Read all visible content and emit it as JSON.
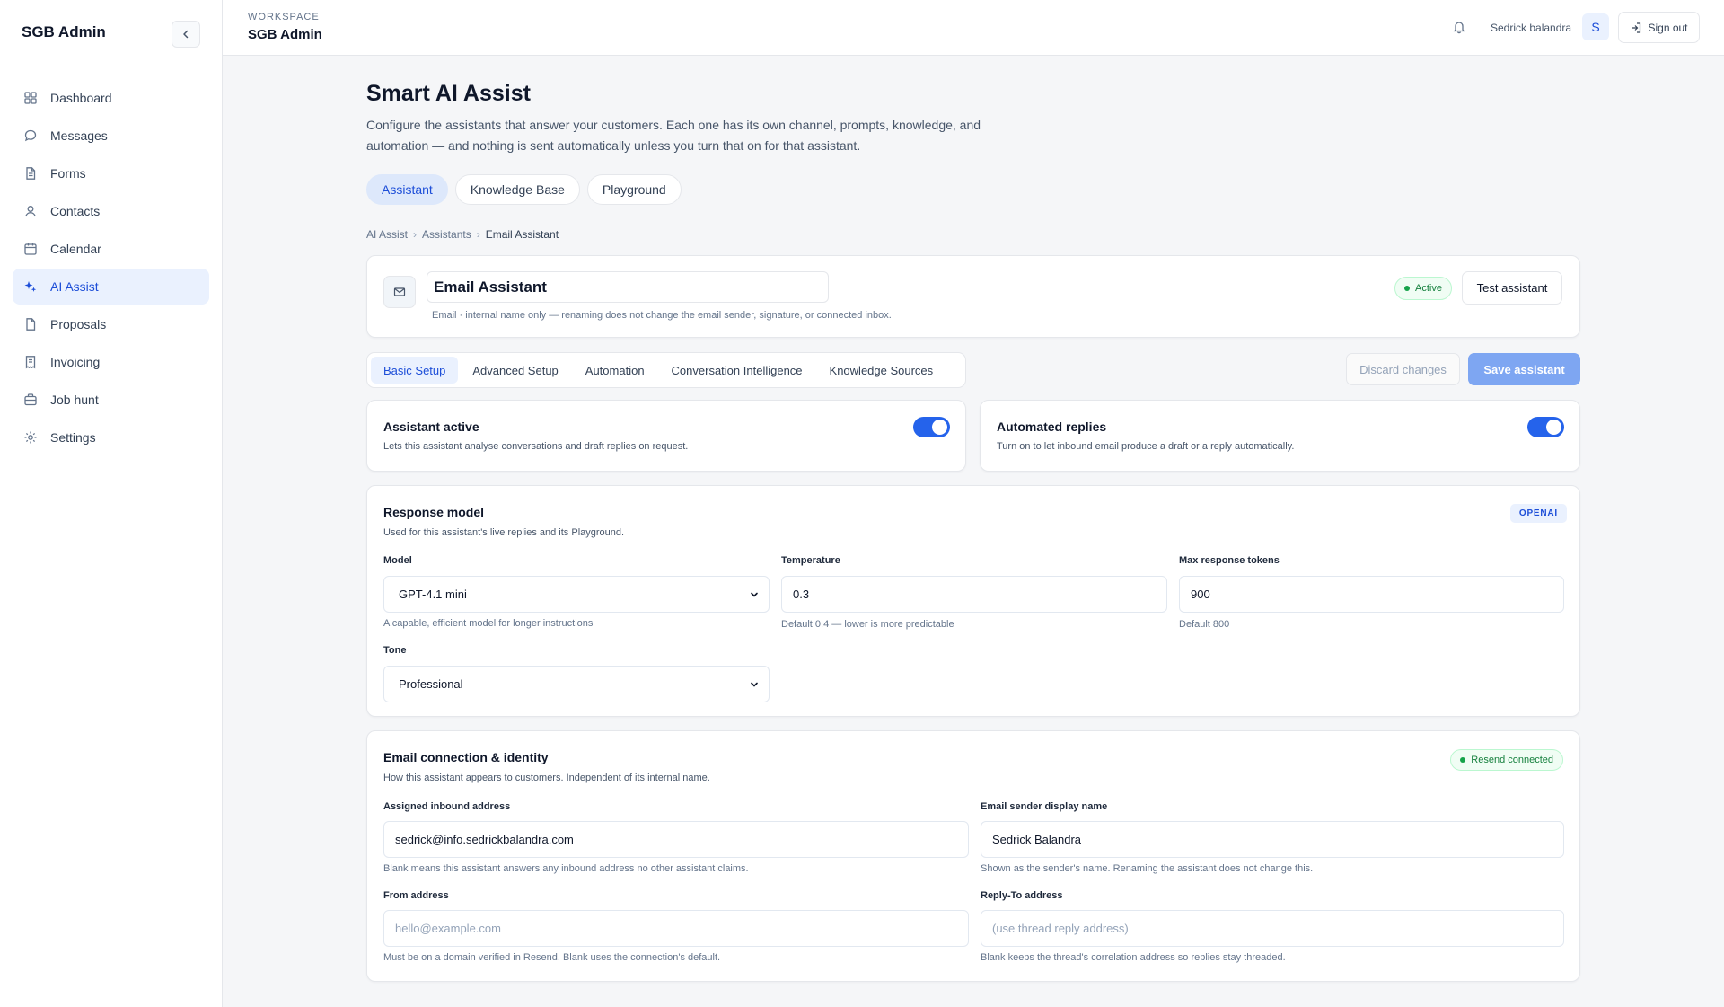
{
  "sidebar": {
    "brand": "SGB Admin",
    "items": [
      {
        "label": "Dashboard",
        "icon": "dashboard-icon"
      },
      {
        "label": "Messages",
        "icon": "message-icon"
      },
      {
        "label": "Forms",
        "icon": "form-icon"
      },
      {
        "label": "Contacts",
        "icon": "user-icon"
      },
      {
        "label": "Calendar",
        "icon": "calendar-icon"
      },
      {
        "label": "AI Assist",
        "icon": "sparkle-icon",
        "active": true
      },
      {
        "label": "Proposals",
        "icon": "document-icon"
      },
      {
        "label": "Invoicing",
        "icon": "invoice-icon"
      },
      {
        "label": "Job hunt",
        "icon": "briefcase-icon"
      },
      {
        "label": "Settings",
        "icon": "gear-icon"
      }
    ]
  },
  "topbar": {
    "workspace_label": "WORKSPACE",
    "workspace_name": "SGB Admin",
    "user_name": "Sedrick balandra",
    "avatar_initial": "S",
    "signout_label": "Sign out"
  },
  "page": {
    "title": "Smart AI Assist",
    "description": "Configure the assistants that answer your customers. Each one has its own channel, prompts, knowledge, and automation — and nothing is sent automatically unless you turn that on for that assistant.",
    "tabs": [
      {
        "label": "Assistant",
        "active": true
      },
      {
        "label": "Knowledge Base"
      },
      {
        "label": "Playground"
      }
    ],
    "breadcrumbs": [
      "AI Assist",
      "Assistants",
      "Email Assistant"
    ]
  },
  "assistant": {
    "name": "Email Assistant",
    "hint": "Email · internal name only — renaming does not change the email sender, signature, or connected inbox.",
    "status": "Active",
    "test_label": "Test assistant"
  },
  "subtabs": [
    {
      "label": "Basic Setup",
      "active": true
    },
    {
      "label": "Advanced Setup"
    },
    {
      "label": "Automation"
    },
    {
      "label": "Conversation Intelligence"
    },
    {
      "label": "Knowledge Sources"
    }
  ],
  "actions": {
    "discard_label": "Discard changes",
    "save_label": "Save assistant"
  },
  "toggles": {
    "active": {
      "title": "Assistant active",
      "desc": "Lets this assistant analyse conversations and draft replies on request.",
      "on": true
    },
    "automated": {
      "title": "Automated replies",
      "desc": "Turn on to let inbound email produce a draft or a reply automatically.",
      "on": true
    }
  },
  "model": {
    "title": "Response model",
    "desc": "Used for this assistant's live replies and its Playground.",
    "provider": "OPENAI",
    "model_label": "Model",
    "model_value": "GPT-4.1 mini",
    "model_hint": "A capable, efficient model for longer instructions",
    "temp_label": "Temperature",
    "temp_value": "0.3",
    "temp_hint": "Default 0.4 — lower is more predictable",
    "tokens_label": "Max response tokens",
    "tokens_value": "900",
    "tokens_hint": "Default 800",
    "tone_label": "Tone",
    "tone_value": "Professional"
  },
  "email": {
    "title": "Email connection & identity",
    "desc": "How this assistant appears to customers. Independent of its internal name.",
    "badge": "Resend connected",
    "inbound_label": "Assigned inbound address",
    "inbound_value": "sedrick@info.sedrickbalandra.com",
    "inbound_hint": "Blank means this assistant answers any inbound address no other assistant claims.",
    "sender_label": "Email sender display name",
    "sender_value": "Sedrick Balandra",
    "sender_hint": "Shown as the sender's name. Renaming the assistant does not change this.",
    "from_label": "From address",
    "from_placeholder": "hello@example.com",
    "from_hint": "Must be on a domain verified in Resend. Blank uses the connection's default.",
    "replyto_label": "Reply-To address",
    "replyto_placeholder": "(use thread reply address)",
    "replyto_hint": "Blank keeps the thread's correlation address so replies stay threaded."
  },
  "colors": {
    "accent": "#2563eb",
    "accent_soft": "#eaf1fe",
    "success": "#16a34a"
  }
}
